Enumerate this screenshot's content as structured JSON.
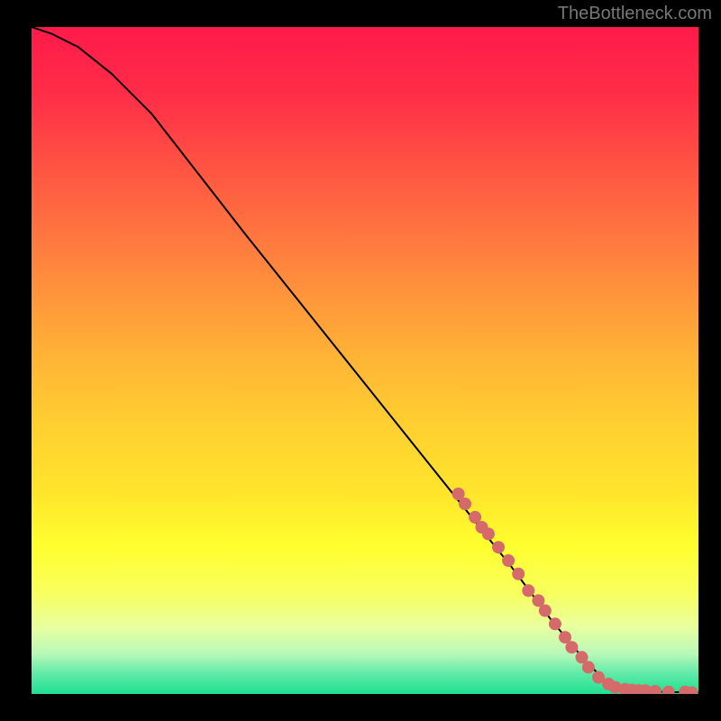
{
  "watermark": "TheBottleneck.com",
  "chart_data": {
    "type": "line",
    "title": "",
    "xlabel": "",
    "ylabel": "",
    "xlim": [
      0,
      100
    ],
    "ylim": [
      0,
      100
    ],
    "gradient_zones": [
      {
        "pos": 0.0,
        "color": "#ff1a4a"
      },
      {
        "pos": 0.1,
        "color": "#ff2d48"
      },
      {
        "pos": 0.2,
        "color": "#ff5043"
      },
      {
        "pos": 0.3,
        "color": "#ff7240"
      },
      {
        "pos": 0.4,
        "color": "#ff943b"
      },
      {
        "pos": 0.5,
        "color": "#ffb536"
      },
      {
        "pos": 0.6,
        "color": "#ffd030"
      },
      {
        "pos": 0.7,
        "color": "#ffe52b"
      },
      {
        "pos": 0.78,
        "color": "#ffff2f"
      },
      {
        "pos": 0.85,
        "color": "#f8ff5f"
      },
      {
        "pos": 0.9,
        "color": "#e8ffa0"
      },
      {
        "pos": 0.94,
        "color": "#b8f8b8"
      },
      {
        "pos": 0.97,
        "color": "#5feaa8"
      },
      {
        "pos": 1.0,
        "color": "#1fe090"
      }
    ],
    "curve": [
      {
        "x": 0,
        "y": 100
      },
      {
        "x": 3,
        "y": 99
      },
      {
        "x": 7,
        "y": 97
      },
      {
        "x": 12,
        "y": 93
      },
      {
        "x": 18,
        "y": 87
      },
      {
        "x": 25,
        "y": 78
      },
      {
        "x": 32,
        "y": 69
      },
      {
        "x": 40,
        "y": 59
      },
      {
        "x": 48,
        "y": 49
      },
      {
        "x": 56,
        "y": 39
      },
      {
        "x": 64,
        "y": 29
      },
      {
        "x": 72,
        "y": 19
      },
      {
        "x": 78,
        "y": 11
      },
      {
        "x": 83,
        "y": 5
      },
      {
        "x": 86,
        "y": 2
      },
      {
        "x": 88,
        "y": 1
      },
      {
        "x": 90,
        "y": 0.5
      },
      {
        "x": 95,
        "y": 0.3
      },
      {
        "x": 100,
        "y": 0.2
      }
    ],
    "points": [
      {
        "x": 64,
        "y": 30
      },
      {
        "x": 65,
        "y": 28.5
      },
      {
        "x": 66.5,
        "y": 26.5
      },
      {
        "x": 67.5,
        "y": 25
      },
      {
        "x": 68.5,
        "y": 24
      },
      {
        "x": 70,
        "y": 22
      },
      {
        "x": 71.5,
        "y": 20
      },
      {
        "x": 73,
        "y": 18
      },
      {
        "x": 74.5,
        "y": 15.5
      },
      {
        "x": 76,
        "y": 14
      },
      {
        "x": 77,
        "y": 12.5
      },
      {
        "x": 78.5,
        "y": 10.5
      },
      {
        "x": 80,
        "y": 8.5
      },
      {
        "x": 81,
        "y": 7
      },
      {
        "x": 82.5,
        "y": 5.5
      },
      {
        "x": 83.5,
        "y": 4
      },
      {
        "x": 85,
        "y": 2.5
      },
      {
        "x": 86.5,
        "y": 1.5
      },
      {
        "x": 87.5,
        "y": 1
      },
      {
        "x": 89,
        "y": 0.7
      },
      {
        "x": 90,
        "y": 0.6
      },
      {
        "x": 91,
        "y": 0.5
      },
      {
        "x": 92,
        "y": 0.5
      },
      {
        "x": 93.5,
        "y": 0.4
      },
      {
        "x": 95.5,
        "y": 0.3
      },
      {
        "x": 98,
        "y": 0.3
      },
      {
        "x": 99,
        "y": 0.2
      }
    ],
    "point_color": "#d46a6a",
    "curve_color": "#000000"
  }
}
